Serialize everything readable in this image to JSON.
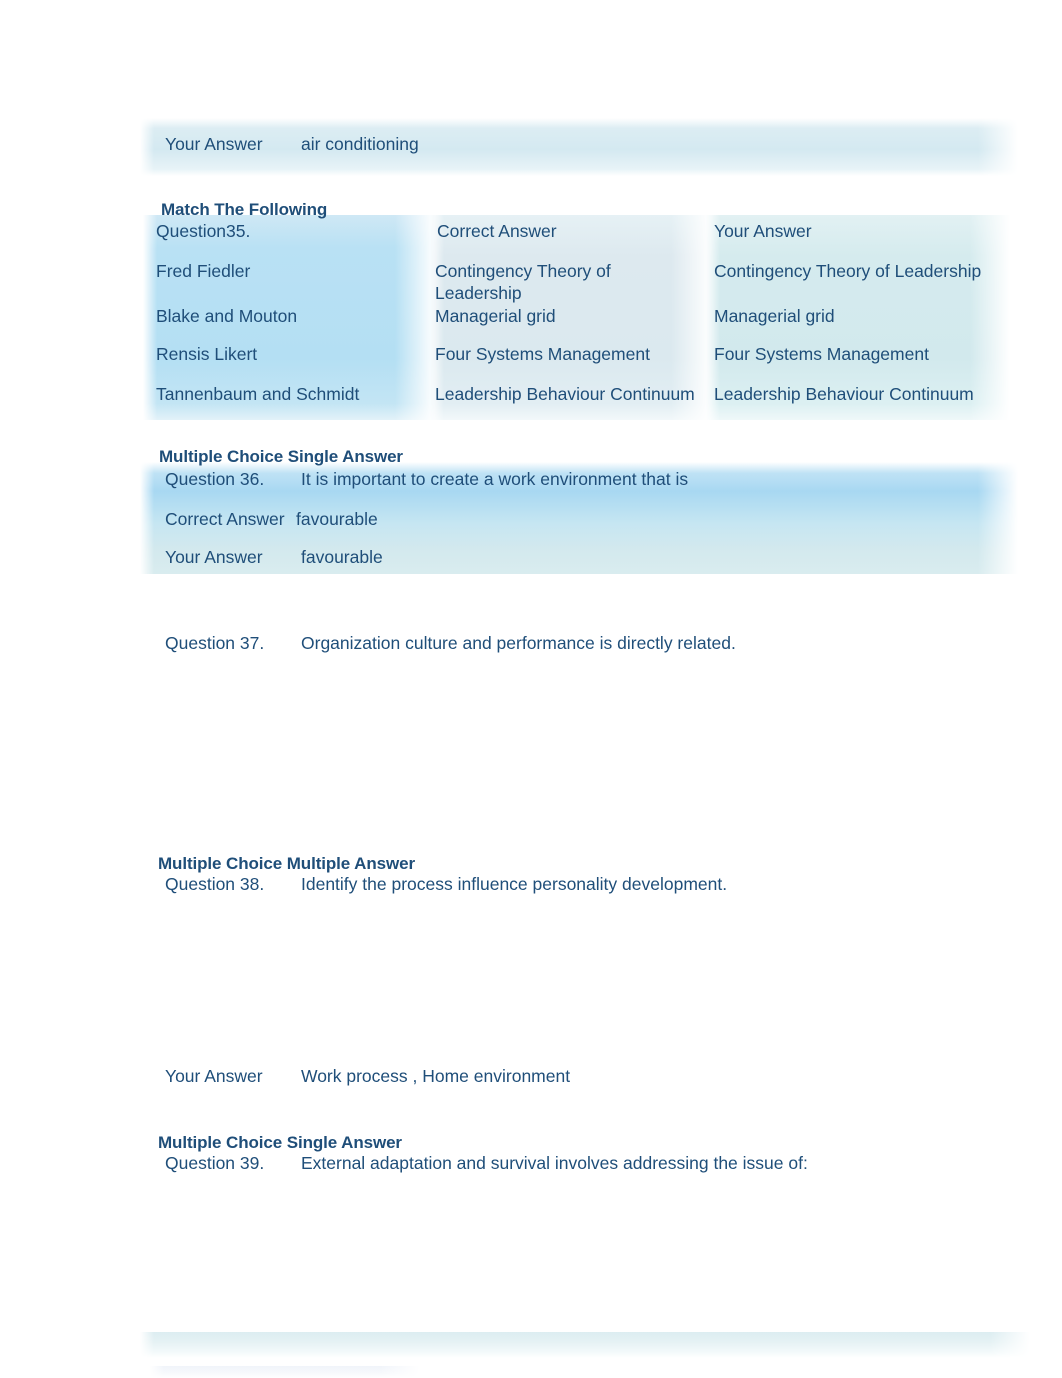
{
  "document": {
    "page_background": "#ffffff",
    "text_color": "#1f4e79",
    "highlight_color": "#a8d8f2"
  },
  "top_answer": {
    "label": "Your Answer",
    "value": "air conditioning"
  },
  "match_section": {
    "heading": "Match The Following",
    "question_label": "Question35.",
    "correct_answer_header": "Correct Answer",
    "your_answer_header": "Your Answer",
    "rows": [
      {
        "item": "Fred Fiedler",
        "correct_answer": "Contingency Theory of Leadership",
        "your_answer": "Contingency Theory of Leadership"
      },
      {
        "item": "Blake and Mouton",
        "correct_answer": "Managerial grid",
        "your_answer": "Managerial grid"
      },
      {
        "item": "Rensis Likert",
        "correct_answer": "Four Systems Management",
        "your_answer": "Four Systems Management"
      },
      {
        "item": "Tannenbaum and Schmidt",
        "correct_answer": "Leadership Behaviour Continuum",
        "your_answer": "Leadership Behaviour Continuum"
      }
    ]
  },
  "question_36": {
    "section_heading": "Multiple Choice Single Answer",
    "number": "Question 36.",
    "text": "It is important to create a work environment that is",
    "correct_answer_label": "Correct Answer",
    "correct_answer": "favourable",
    "your_answer_label": "Your Answer",
    "your_answer": "favourable"
  },
  "question_37": {
    "number": "Question 37.",
    "text": "Organization culture and performance is directly related."
  },
  "question_38": {
    "section_heading": "Multiple Choice Multiple Answer",
    "number": "Question 38.",
    "text": "Identify the process influence personality development.",
    "your_answer_label": "Your Answer",
    "your_answer": "Work process , Home environment"
  },
  "question_39": {
    "section_heading": "Multiple Choice Single Answer",
    "number": "Question 39.",
    "text": "External adaptation and survival involves addressing the issue of:"
  }
}
